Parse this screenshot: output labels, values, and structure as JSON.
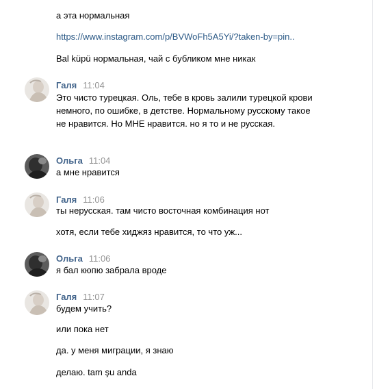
{
  "messages_top": [
    {
      "text": "а эта нормальная"
    },
    {
      "text": "https://www.instagram.com/p/BVWoFh5A5Yi/?taken-by=pin..",
      "is_link": true
    },
    {
      "text": "Bal küpü нормальная, чай с бубликом мне никак"
    }
  ],
  "groups": [
    {
      "author": "Галя",
      "time": "11:04",
      "avatar": "photo-avatar-light",
      "messages": [
        "Это чисто турецкая. Оль, тебе в кровь залили турецкой крови немного, по ошибке, в детстве. Нормальному русскому такое не нравится. Но МНЕ нравится. но я то и не русская."
      ]
    },
    {
      "author": "Ольга",
      "time": "11:04",
      "avatar": "photo-avatar-dark",
      "messages": [
        "а мне нравится"
      ]
    },
    {
      "author": "Галя",
      "time": "11:06",
      "avatar": "photo-avatar-light",
      "messages": [
        "ты нерусская. там чисто восточная комбинация нот",
        "хотя, если тебе хиджяз нравится, то что уж..."
      ]
    },
    {
      "author": "Ольга",
      "time": "11:06",
      "avatar": "photo-avatar-dark",
      "messages": [
        "я бал кюпю забрала вроде"
      ]
    },
    {
      "author": "Галя",
      "time": "11:07",
      "avatar": "photo-avatar-light",
      "messages": [
        "будем учить?",
        "или пока нет",
        "да. у меня миграции, я знаю",
        "делаю. tam şu anda"
      ]
    }
  ]
}
